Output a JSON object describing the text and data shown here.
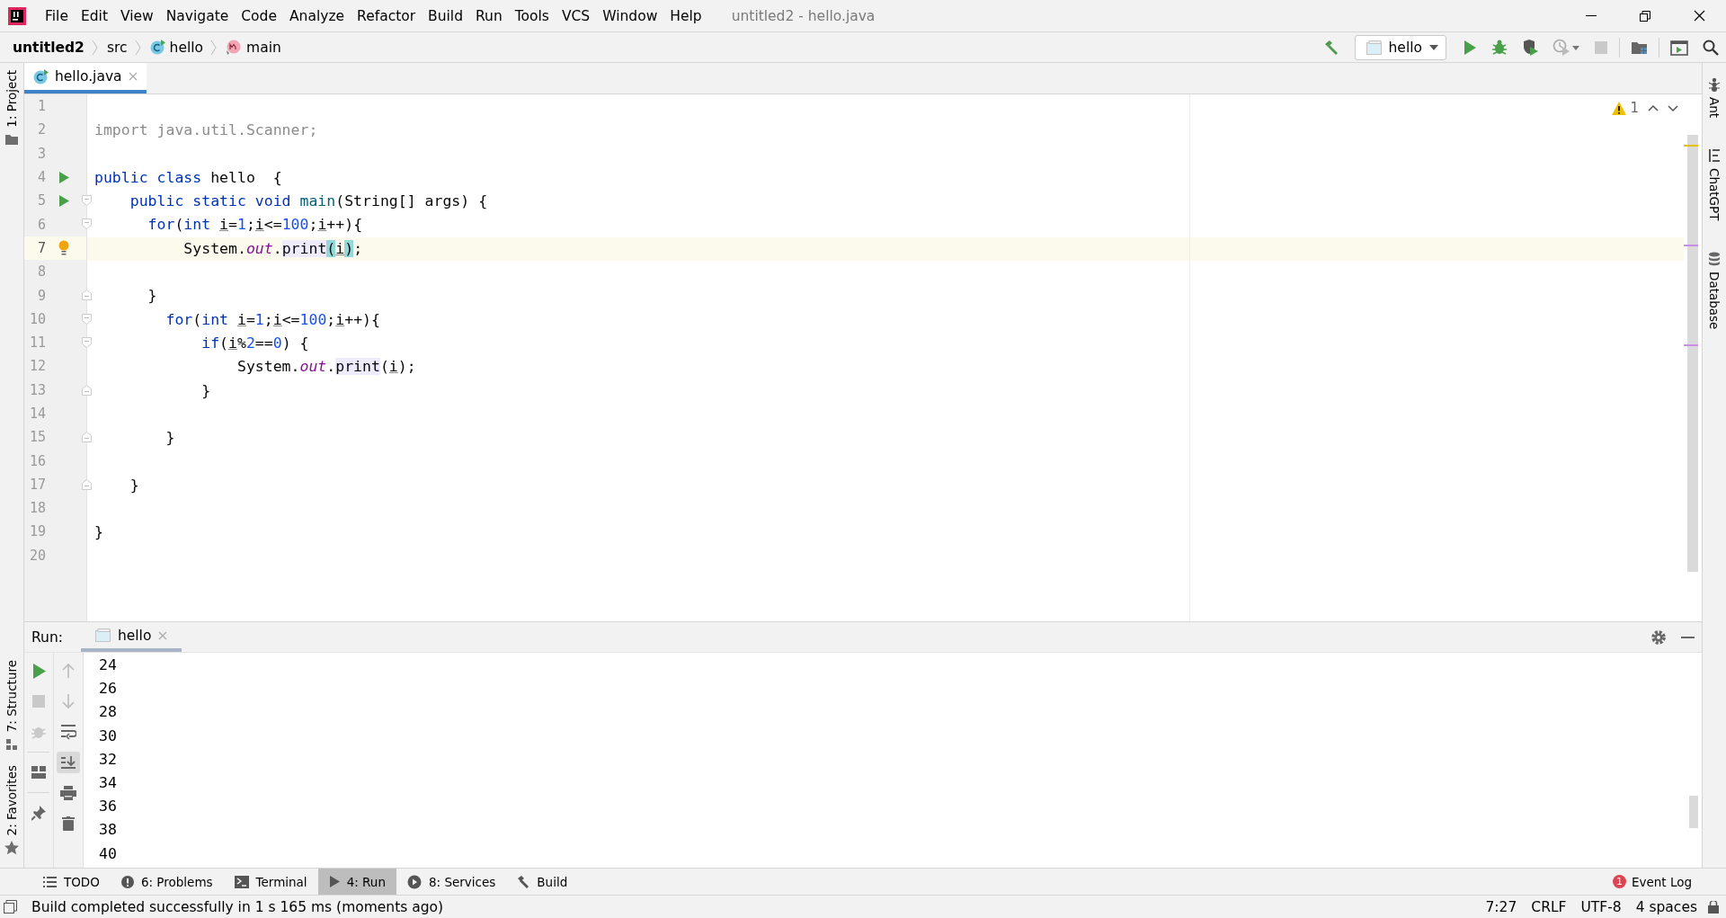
{
  "window": {
    "title": "untitled2 - hello.java"
  },
  "menu": [
    "File",
    "Edit",
    "View",
    "Navigate",
    "Code",
    "Analyze",
    "Refactor",
    "Build",
    "Run",
    "Tools",
    "VCS",
    "Window",
    "Help"
  ],
  "breadcrumbs": [
    {
      "label": "untitled2",
      "kind": "project"
    },
    {
      "label": "src",
      "kind": "folder"
    },
    {
      "label": "hello",
      "kind": "class"
    },
    {
      "label": "main",
      "kind": "method"
    }
  ],
  "run_configuration": {
    "label": "hello"
  },
  "left_tool_windows": [
    {
      "label": "1: Project"
    },
    {
      "label": "7: Structure"
    },
    {
      "label": "2: Favorites"
    }
  ],
  "right_tool_windows": [
    {
      "label": "Ant"
    },
    {
      "label": "ChatGPT"
    },
    {
      "label": "Database"
    }
  ],
  "editor_tabs": [
    {
      "label": "hello.java",
      "selected": true
    }
  ],
  "inspection": {
    "warnings": "1"
  },
  "code_lines": [
    {
      "number": "1",
      "current": false,
      "runnable": false,
      "intention": false,
      "fold_start": false,
      "fold_end": false
    },
    {
      "number": "2",
      "current": false,
      "runnable": false,
      "intention": false,
      "fold_start": false,
      "fold_end": false,
      "tokens": [
        {
          "text": "import java.util.Scanner;",
          "kind": "unused"
        }
      ]
    },
    {
      "number": "3",
      "current": false,
      "runnable": false,
      "intention": false,
      "fold_start": false,
      "fold_end": false
    },
    {
      "number": "4",
      "current": false,
      "runnable": true,
      "intention": false,
      "fold_start": false,
      "fold_end": false,
      "tokens": [
        {
          "text": "public class ",
          "kind": "keyword"
        },
        {
          "text": "hello  {",
          "kind": "plain"
        }
      ]
    },
    {
      "number": "5",
      "current": false,
      "runnable": true,
      "intention": false,
      "fold_start": true,
      "fold_end": false,
      "tokens": [
        {
          "text": "    public static void ",
          "kind": "keyword"
        },
        {
          "text": "main",
          "kind": "method"
        },
        {
          "text": "(String[] args) {",
          "kind": "plain"
        }
      ]
    },
    {
      "number": "6",
      "current": false,
      "runnable": false,
      "intention": false,
      "fold_start": true,
      "fold_end": false,
      "tokens": [
        {
          "text": "      for",
          "kind": "keyword"
        },
        {
          "text": "(",
          "kind": "plain"
        },
        {
          "text": "int ",
          "kind": "keyword"
        },
        {
          "text": "i",
          "kind": "var"
        },
        {
          "text": "=",
          "kind": "plain"
        },
        {
          "text": "1",
          "kind": "number"
        },
        {
          "text": ";",
          "kind": "plain"
        },
        {
          "text": "i",
          "kind": "var"
        },
        {
          "text": "<=",
          "kind": "plain"
        },
        {
          "text": "100",
          "kind": "number"
        },
        {
          "text": ";",
          "kind": "plain"
        },
        {
          "text": "i",
          "kind": "var"
        },
        {
          "text": "++){",
          "kind": "plain"
        }
      ]
    },
    {
      "number": "7",
      "current": true,
      "runnable": false,
      "intention": true,
      "fold_start": false,
      "fold_end": false,
      "tokens": [
        {
          "text": "          System.",
          "kind": "plain"
        },
        {
          "text": "out",
          "kind": "static"
        },
        {
          "text": ".",
          "kind": "plain"
        },
        {
          "text": "print",
          "kind": "usage"
        },
        {
          "text": "(",
          "kind": "match"
        },
        {
          "text": "i",
          "kind": "var"
        },
        {
          "text": ")",
          "kind": "match"
        },
        {
          "text": ";",
          "kind": "plain"
        }
      ]
    },
    {
      "number": "8",
      "current": false,
      "runnable": false,
      "intention": false,
      "fold_start": false,
      "fold_end": false
    },
    {
      "number": "9",
      "current": false,
      "runnable": false,
      "intention": false,
      "fold_start": false,
      "fold_end": true,
      "tokens": [
        {
          "text": "      }",
          "kind": "plain"
        }
      ]
    },
    {
      "number": "10",
      "current": false,
      "runnable": false,
      "intention": false,
      "fold_start": true,
      "fold_end": false,
      "tokens": [
        {
          "text": "        for",
          "kind": "keyword"
        },
        {
          "text": "(",
          "kind": "plain"
        },
        {
          "text": "int ",
          "kind": "keyword"
        },
        {
          "text": "i",
          "kind": "var"
        },
        {
          "text": "=",
          "kind": "plain"
        },
        {
          "text": "1",
          "kind": "number"
        },
        {
          "text": ";",
          "kind": "plain"
        },
        {
          "text": "i",
          "kind": "var"
        },
        {
          "text": "<=",
          "kind": "plain"
        },
        {
          "text": "100",
          "kind": "number"
        },
        {
          "text": ";",
          "kind": "plain"
        },
        {
          "text": "i",
          "kind": "var"
        },
        {
          "text": "++){",
          "kind": "plain"
        }
      ]
    },
    {
      "number": "11",
      "current": false,
      "runnable": false,
      "intention": false,
      "fold_start": true,
      "fold_end": false,
      "tokens": [
        {
          "text": "            if",
          "kind": "keyword"
        },
        {
          "text": "(",
          "kind": "plain"
        },
        {
          "text": "i",
          "kind": "var"
        },
        {
          "text": "%",
          "kind": "plain"
        },
        {
          "text": "2",
          "kind": "number"
        },
        {
          "text": "==",
          "kind": "plain"
        },
        {
          "text": "0",
          "kind": "number"
        },
        {
          "text": ") {",
          "kind": "plain"
        }
      ]
    },
    {
      "number": "12",
      "current": false,
      "runnable": false,
      "intention": false,
      "fold_start": false,
      "fold_end": false,
      "tokens": [
        {
          "text": "                System.",
          "kind": "plain"
        },
        {
          "text": "out",
          "kind": "static"
        },
        {
          "text": ".",
          "kind": "plain"
        },
        {
          "text": "print",
          "kind": "usage"
        },
        {
          "text": "(",
          "kind": "plain"
        },
        {
          "text": "i",
          "kind": "var"
        },
        {
          "text": ");",
          "kind": "plain"
        }
      ]
    },
    {
      "number": "13",
      "current": false,
      "runnable": false,
      "intention": false,
      "fold_start": false,
      "fold_end": true,
      "tokens": [
        {
          "text": "            }",
          "kind": "plain"
        }
      ]
    },
    {
      "number": "14",
      "current": false,
      "runnable": false,
      "intention": false,
      "fold_start": false,
      "fold_end": false
    },
    {
      "number": "15",
      "current": false,
      "runnable": false,
      "intention": false,
      "fold_start": false,
      "fold_end": true,
      "tokens": [
        {
          "text": "        }",
          "kind": "plain"
        }
      ]
    },
    {
      "number": "16",
      "current": false,
      "runnable": false,
      "intention": false,
      "fold_start": false,
      "fold_end": false
    },
    {
      "number": "17",
      "current": false,
      "runnable": false,
      "intention": false,
      "fold_start": false,
      "fold_end": true,
      "tokens": [
        {
          "text": "    }",
          "kind": "plain"
        }
      ]
    },
    {
      "number": "18",
      "current": false,
      "runnable": false,
      "intention": false,
      "fold_start": false,
      "fold_end": false
    },
    {
      "number": "19",
      "current": false,
      "runnable": false,
      "intention": false,
      "fold_start": false,
      "fold_end": false,
      "tokens": [
        {
          "text": "}",
          "kind": "plain"
        }
      ]
    },
    {
      "number": "20",
      "current": false,
      "runnable": false,
      "intention": false,
      "fold_start": false,
      "fold_end": false
    }
  ],
  "run_panel": {
    "label": "Run:",
    "tabs": [
      {
        "label": "hello",
        "selected": true
      }
    ],
    "output": [
      "24",
      "26",
      "28",
      "30",
      "32",
      "34",
      "36",
      "38",
      "40"
    ]
  },
  "tool_tabs": [
    {
      "label": "TODO",
      "selected": false
    },
    {
      "label": "6: Problems",
      "selected": false
    },
    {
      "label": "Terminal",
      "selected": false
    },
    {
      "label": "4: Run",
      "selected": true
    },
    {
      "label": "8: Services",
      "selected": false
    },
    {
      "label": "Build",
      "selected": false
    }
  ],
  "event_log": {
    "label": "Event Log",
    "badge": "1"
  },
  "status_bar": {
    "message": "Build completed successfully in 1 s 165 ms (moments ago)",
    "position": "7:27",
    "line_separator": "CRLF",
    "encoding": "UTF-8",
    "indent": "4 spaces"
  }
}
